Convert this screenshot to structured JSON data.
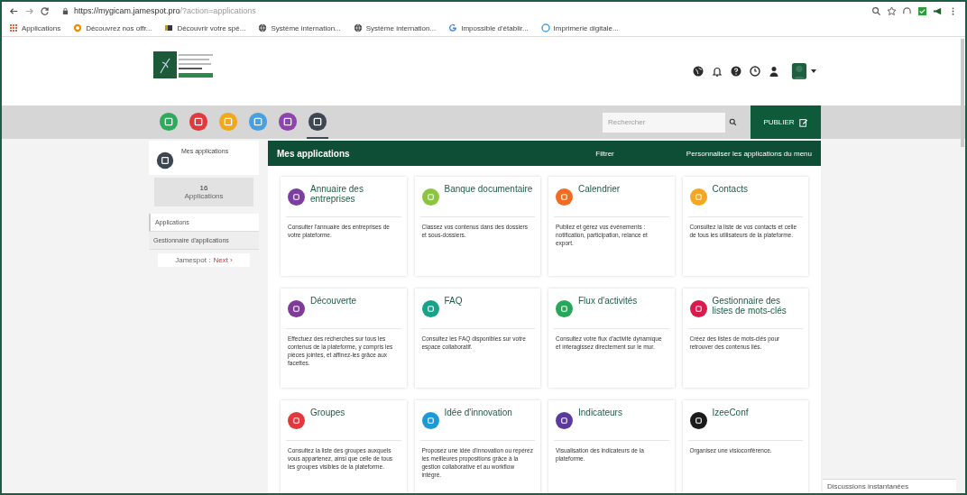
{
  "browser": {
    "url_host": "https://mygicam.jamespot.pro",
    "url_path": "/?action=applications",
    "bookmarks": [
      {
        "label": "Applications",
        "kind": "apps"
      },
      {
        "label": "Découvrez nos offr...",
        "kind": "orange"
      },
      {
        "label": "Découvrir votre spé...",
        "kind": "book"
      },
      {
        "label": "Système internation...",
        "kind": "globe"
      },
      {
        "label": "Système internation...",
        "kind": "globe"
      },
      {
        "label": "Impossible d'établir...",
        "kind": "google"
      },
      {
        "label": "Imprimerie digitale...",
        "kind": "blue"
      }
    ]
  },
  "app_shortcuts": [
    {
      "color": "#2eaa5c",
      "selected": false
    },
    {
      "color": "#e0393e",
      "selected": false
    },
    {
      "color": "#f2a81d",
      "selected": false
    },
    {
      "color": "#4a9fe0",
      "selected": false
    },
    {
      "color": "#8e44ad",
      "selected": false
    },
    {
      "color": "#3d4653",
      "selected": true
    }
  ],
  "search": {
    "placeholder": "Rechercher"
  },
  "publish_button": "PUBLIER",
  "sidebar": {
    "title": "Mes applications",
    "count": "16",
    "count_label": "Applications",
    "items": [
      {
        "label": "Applications",
        "selected": true
      },
      {
        "label": "Gestionnaire d'applications",
        "selected": false
      }
    ],
    "footer_brand": "Jamespot :",
    "footer_link": "Next ›"
  },
  "panel": {
    "title": "Mes applications",
    "filter": "Filtrer",
    "customize": "Personnaliser les applications du menu"
  },
  "apps": [
    {
      "title": "Annuaire des entreprises",
      "description": "Consulter l'annuaire des entreprises de votre plateforme.",
      "color": "#7b3f9e"
    },
    {
      "title": "Banque documentaire",
      "description": "Classez vos contenus dans des dossiers et sous-dossiers.",
      "color": "#8cc63f"
    },
    {
      "title": "Calendrier",
      "description": "Publiez et gérez vos événements : notification, participation, relance et export.",
      "color": "#f26b21"
    },
    {
      "title": "Contacts",
      "description": "Consultez la liste de vos contacts et celle de tous les utilisateurs de la plateforme.",
      "color": "#f5a623"
    },
    {
      "title": "Découverte",
      "description": "Effectuez des recherches sur tous les contenus de la plateforme, y compris les pièces jointes, et affinez-les grâce aux facettes.",
      "color": "#7d3c98"
    },
    {
      "title": "FAQ",
      "description": "Consultez les FAQ disponibles sur votre espace collaboratif.",
      "color": "#17a28a"
    },
    {
      "title": "Flux d'activités",
      "description": "Consultez votre flux d'activité dynamique et interagissez directement sur le mur.",
      "color": "#27a75a"
    },
    {
      "title": "Gestionnaire des listes de mots-clés",
      "description": "Créez des listes de mots-clés pour retrouver des contenus liés.",
      "color": "#d81b4a"
    },
    {
      "title": "Groupes",
      "description": "Consultez la liste des groupes auxquels vous appartenez, ainsi que celle de tous les groupes visibles de la plateforme.",
      "color": "#e03a3e"
    },
    {
      "title": "Idée d'innovation",
      "description": "Proposez une idée d'innovation ou repérez les meilleures propositions grâce à la gestion collaborative et au workflow intégré.",
      "color": "#1a9ad6"
    },
    {
      "title": "Indicateurs",
      "description": "Visualisation des indicateurs de la plateforme.",
      "color": "#5b3a9e"
    },
    {
      "title": "IzeeConf",
      "description": "Organisez une visioconférence.",
      "color": "#1b1b1b"
    }
  ],
  "chat_tab": "Discussions instantanées"
}
